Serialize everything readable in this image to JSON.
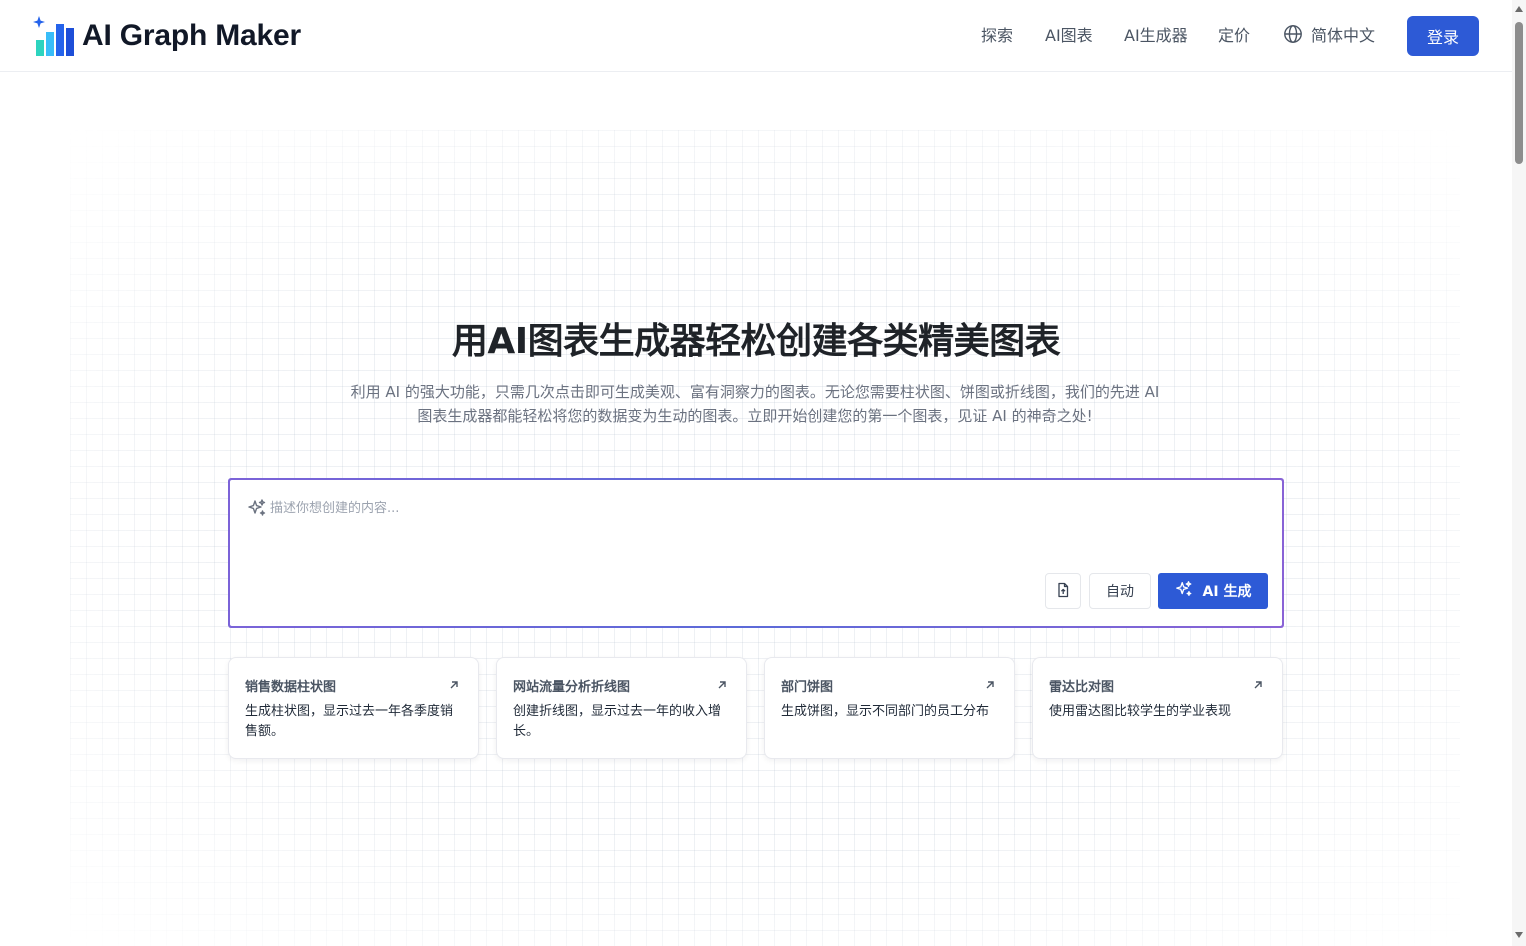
{
  "header": {
    "brand": "AI Graph Maker",
    "nav": [
      {
        "label": "探索"
      },
      {
        "label": "AI图表"
      },
      {
        "label": "AI生成器"
      },
      {
        "label": "定价"
      }
    ],
    "language": "简体中文",
    "login_label": "登录"
  },
  "hero": {
    "title": "用AI图表生成器轻松创建各类精美图表",
    "subtitle": "利用 AI 的强大功能，只需几次点击即可生成美观、富有洞察力的图表。无论您需要柱状图、饼图或折线图，我们的先进 AI 图表生成器都能轻松将您的数据变为生动的图表。立即开始创建您的第一个图表，见证 AI 的神奇之处!"
  },
  "prompt": {
    "placeholder": "描述你想创建的内容...",
    "value": "",
    "auto_label": "自动",
    "generate_label": "AI 生成"
  },
  "examples": [
    {
      "title": "销售数据柱状图",
      "desc": "生成柱状图，显示过去一年各季度销售额。"
    },
    {
      "title": "网站流量分析折线图",
      "desc": "创建折线图，显示过去一年的收入增长。"
    },
    {
      "title": "部门饼图",
      "desc": "生成饼图，显示不同部门的员工分布"
    },
    {
      "title": "雷达比对图",
      "desc": "使用雷达图比较学生的学业表现"
    }
  ],
  "colors": {
    "primary": "#2d5ad6",
    "prompt_border_start": "#7c63d8",
    "prompt_border_end": "#8a63d6",
    "logo_blue": "#2563eb",
    "logo_teal": "#2dd4bf"
  },
  "icons": {
    "logo": "bar-chart-sparkle-icon",
    "language": "globe-icon",
    "prompt": "sparkles-icon",
    "upload": "file-upload-icon",
    "generate": "sparkles-icon",
    "card": "arrow-up-right-icon"
  }
}
